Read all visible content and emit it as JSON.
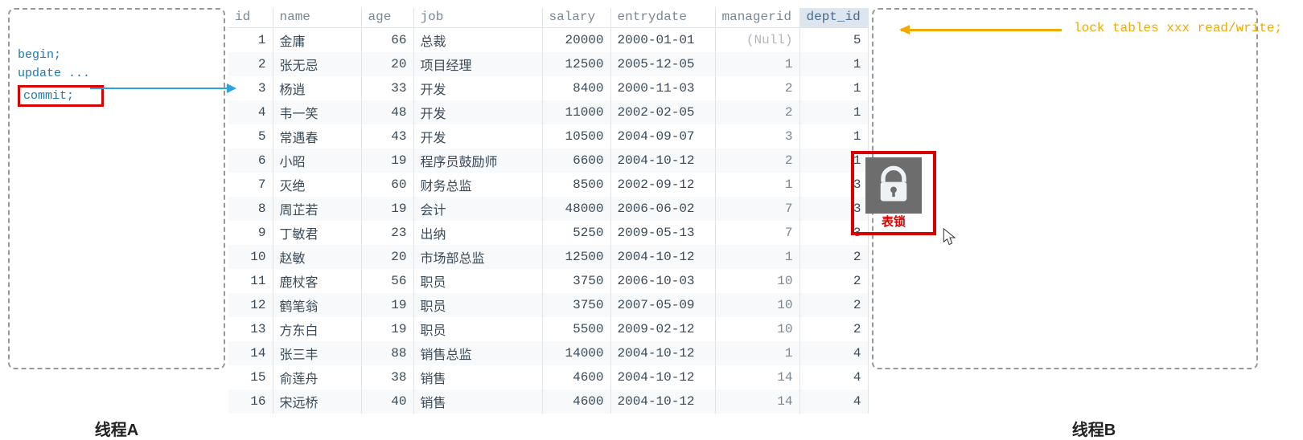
{
  "panelA": {
    "begin": "begin;",
    "update": "update ...",
    "commit": "commit;",
    "thread_label": "线程A"
  },
  "panelB": {
    "lock_cmd": "lock tables xxx read/write;",
    "thread_label": "线程B"
  },
  "lock": {
    "caption": "表锁"
  },
  "table": {
    "headers": {
      "id": "id",
      "name": "name",
      "age": "age",
      "job": "job",
      "salary": "salary",
      "entrydate": "entrydate",
      "managerid": "managerid",
      "dept_id": "dept_id"
    },
    "rows": [
      {
        "id": 1,
        "name": "金庸",
        "age": 66,
        "job": "总裁",
        "salary": 20000,
        "entrydate": "2000-01-01",
        "managerid": "(Null)",
        "dept_id": 5
      },
      {
        "id": 2,
        "name": "张无忌",
        "age": 20,
        "job": "项目经理",
        "salary": 12500,
        "entrydate": "2005-12-05",
        "managerid": 1,
        "dept_id": 1
      },
      {
        "id": 3,
        "name": "杨逍",
        "age": 33,
        "job": "开发",
        "salary": 8400,
        "entrydate": "2000-11-03",
        "managerid": 2,
        "dept_id": 1
      },
      {
        "id": 4,
        "name": "韦一笑",
        "age": 48,
        "job": "开发",
        "salary": 11000,
        "entrydate": "2002-02-05",
        "managerid": 2,
        "dept_id": 1
      },
      {
        "id": 5,
        "name": "常遇春",
        "age": 43,
        "job": "开发",
        "salary": 10500,
        "entrydate": "2004-09-07",
        "managerid": 3,
        "dept_id": 1
      },
      {
        "id": 6,
        "name": "小昭",
        "age": 19,
        "job": "程序员鼓励师",
        "salary": 6600,
        "entrydate": "2004-10-12",
        "managerid": 2,
        "dept_id": 1
      },
      {
        "id": 7,
        "name": "灭绝",
        "age": 60,
        "job": "财务总监",
        "salary": 8500,
        "entrydate": "2002-09-12",
        "managerid": 1,
        "dept_id": 3
      },
      {
        "id": 8,
        "name": "周芷若",
        "age": 19,
        "job": "会计",
        "salary": 48000,
        "entrydate": "2006-06-02",
        "managerid": 7,
        "dept_id": 3
      },
      {
        "id": 9,
        "name": "丁敏君",
        "age": 23,
        "job": "出纳",
        "salary": 5250,
        "entrydate": "2009-05-13",
        "managerid": 7,
        "dept_id": 3
      },
      {
        "id": 10,
        "name": "赵敏",
        "age": 20,
        "job": "市场部总监",
        "salary": 12500,
        "entrydate": "2004-10-12",
        "managerid": 1,
        "dept_id": 2
      },
      {
        "id": 11,
        "name": "鹿杖客",
        "age": 56,
        "job": "职员",
        "salary": 3750,
        "entrydate": "2006-10-03",
        "managerid": 10,
        "dept_id": 2
      },
      {
        "id": 12,
        "name": "鹤笔翁",
        "age": 19,
        "job": "职员",
        "salary": 3750,
        "entrydate": "2007-05-09",
        "managerid": 10,
        "dept_id": 2
      },
      {
        "id": 13,
        "name": "方东白",
        "age": 19,
        "job": "职员",
        "salary": 5500,
        "entrydate": "2009-02-12",
        "managerid": 10,
        "dept_id": 2
      },
      {
        "id": 14,
        "name": "张三丰",
        "age": 88,
        "job": "销售总监",
        "salary": 14000,
        "entrydate": "2004-10-12",
        "managerid": 1,
        "dept_id": 4
      },
      {
        "id": 15,
        "name": "俞莲舟",
        "age": 38,
        "job": "销售",
        "salary": 4600,
        "entrydate": "2004-10-12",
        "managerid": 14,
        "dept_id": 4
      },
      {
        "id": 16,
        "name": "宋远桥",
        "age": 40,
        "job": "销售",
        "salary": 4600,
        "entrydate": "2004-10-12",
        "managerid": 14,
        "dept_id": 4
      }
    ]
  }
}
